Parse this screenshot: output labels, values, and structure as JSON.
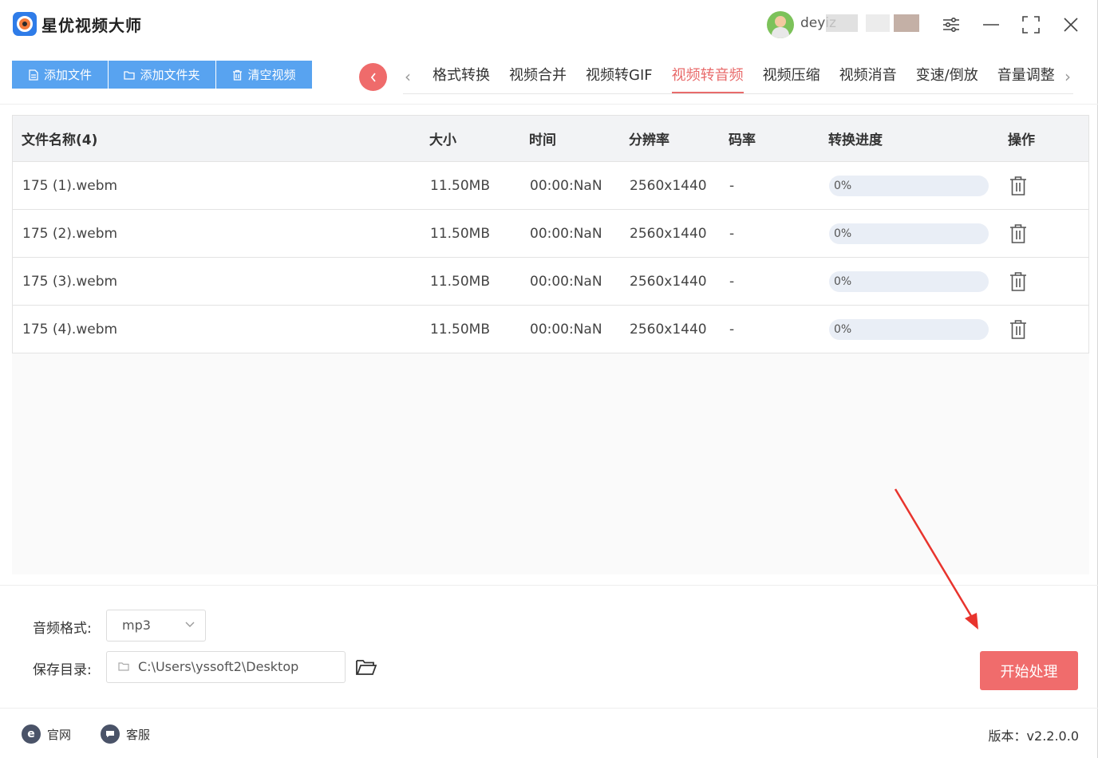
{
  "app": {
    "title": "星优视频大师"
  },
  "user": {
    "name": "deyiz"
  },
  "toolbar": {
    "add_file": "添加文件",
    "add_folder": "添加文件夹",
    "clear_videos": "清空视频"
  },
  "tabs": [
    {
      "label": "格式转换"
    },
    {
      "label": "视频合并"
    },
    {
      "label": "视频转GIF"
    },
    {
      "label": "视频转音频",
      "active": true
    },
    {
      "label": "视频压缩"
    },
    {
      "label": "视频消音"
    },
    {
      "label": "变速/倒放"
    },
    {
      "label": "音量调整"
    }
  ],
  "table": {
    "headers": {
      "name": "文件名称(4)",
      "size": "大小",
      "time": "时间",
      "resolution": "分辨率",
      "bitrate": "码率",
      "progress": "转换进度",
      "action": "操作"
    },
    "rows": [
      {
        "name": "175 (1).webm",
        "size": "11.50MB",
        "time": "00:00:NaN",
        "resolution": "2560x1440",
        "bitrate": "-",
        "progress_label": "0%",
        "progress": 0
      },
      {
        "name": "175 (2).webm",
        "size": "11.50MB",
        "time": "00:00:NaN",
        "resolution": "2560x1440",
        "bitrate": "-",
        "progress_label": "0%",
        "progress": 0
      },
      {
        "name": "175 (3).webm",
        "size": "11.50MB",
        "time": "00:00:NaN",
        "resolution": "2560x1440",
        "bitrate": "-",
        "progress_label": "0%",
        "progress": 0
      },
      {
        "name": "175 (4).webm",
        "size": "11.50MB",
        "time": "00:00:NaN",
        "resolution": "2560x1440",
        "bitrate": "-",
        "progress_label": "0%",
        "progress": 0
      }
    ]
  },
  "settings": {
    "audio_format_label": "音频格式:",
    "audio_format_value": "mp3",
    "save_dir_label": "保存目录:",
    "save_dir_value": "C:\\Users\\yssoft2\\Desktop",
    "start_label": "开始处理"
  },
  "footer": {
    "website": "官网",
    "support": "客服",
    "version": "版本：v2.2.0.0"
  },
  "colors": {
    "accent_blue": "#58a3f0",
    "accent_red": "#f06c6c",
    "tab_active": "#e86b6b"
  }
}
